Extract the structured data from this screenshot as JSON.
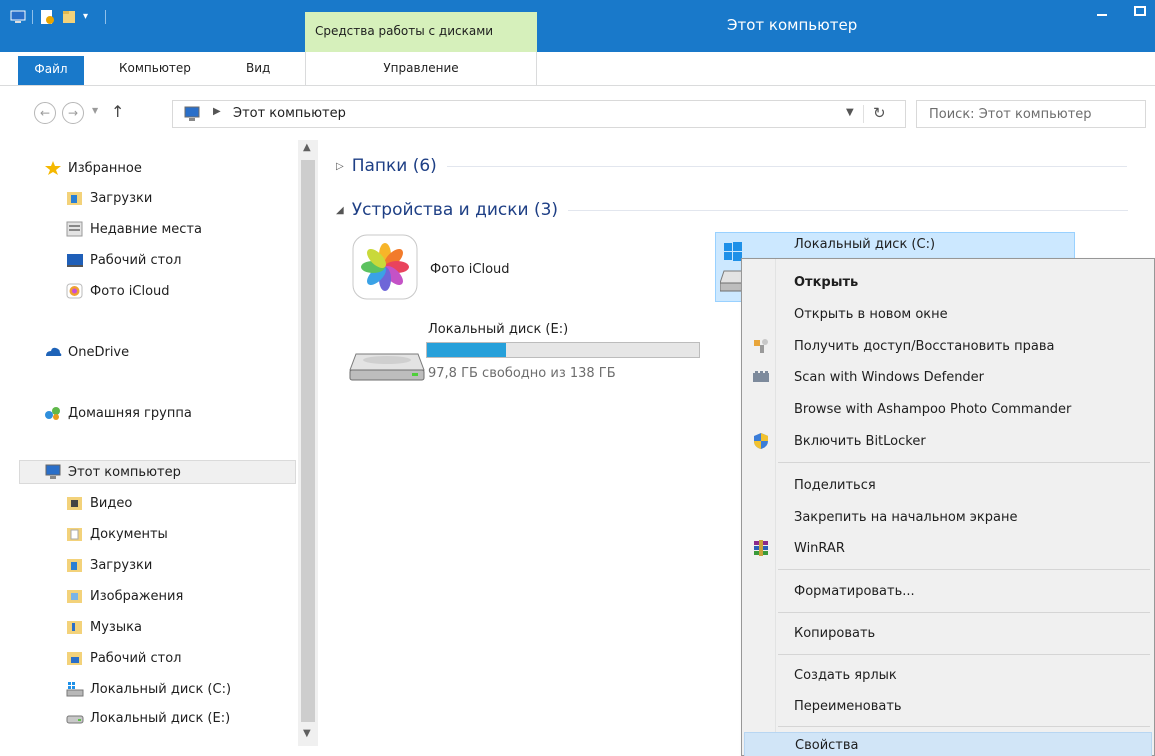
{
  "window": {
    "title": "Этот компьютер",
    "context_tab_group": "Средства работы с дисками"
  },
  "ribbon": {
    "tabs": [
      {
        "label": "Файл"
      },
      {
        "label": "Компьютер"
      },
      {
        "label": "Вид"
      },
      {
        "label": "Управление"
      }
    ]
  },
  "address": {
    "path": "Этот компьютер",
    "search_placeholder": "Поиск: Этот компьютер"
  },
  "navpane": {
    "items": [
      {
        "label": "Избранное",
        "icon": "star-icon"
      },
      {
        "label": "Загрузки",
        "icon": "downloads-folder-icon"
      },
      {
        "label": "Недавние места",
        "icon": "recent-places-icon"
      },
      {
        "label": "Рабочий стол",
        "icon": "desktop-icon"
      },
      {
        "label": "Фото iCloud",
        "icon": "icloud-photos-icon"
      },
      {
        "label": "OneDrive",
        "icon": "onedrive-icon"
      },
      {
        "label": "Домашняя группа",
        "icon": "homegroup-icon"
      },
      {
        "label": "Этот компьютер",
        "icon": "computer-icon"
      },
      {
        "label": "Видео",
        "icon": "video-folder-icon"
      },
      {
        "label": "Документы",
        "icon": "documents-folder-icon"
      },
      {
        "label": "Загрузки",
        "icon": "downloads-folder-icon"
      },
      {
        "label": "Изображения",
        "icon": "pictures-folder-icon"
      },
      {
        "label": "Музыка",
        "icon": "music-folder-icon"
      },
      {
        "label": "Рабочий стол",
        "icon": "desktop-folder-icon"
      },
      {
        "label": "Локальный диск (C:)",
        "icon": "system-drive-icon"
      },
      {
        "label": "Локальный диск (E:)",
        "icon": "drive-icon"
      }
    ]
  },
  "content": {
    "groups": [
      {
        "label": "Папки (6)",
        "expanded": false
      },
      {
        "label": "Устройства и диски (3)",
        "expanded": true
      }
    ],
    "devices": [
      {
        "label": "Фото iCloud",
        "icon": "icloud-photos-icon"
      },
      {
        "label": "Локальный диск (E:)",
        "free_text": "97,8 ГБ свободно из 138 ГБ",
        "used_fraction": 0.29,
        "icon": "drive-icon"
      },
      {
        "label": "Локальный диск (C:)",
        "icon": "system-drive-icon",
        "selected": true
      }
    ]
  },
  "context_menu": {
    "items": [
      {
        "label": "Открыть",
        "bold": true
      },
      {
        "label": "Открыть в новом окне"
      },
      {
        "label": "Получить доступ/Восстановить права",
        "icon": "take-ownership-icon"
      },
      {
        "label": "Scan with Windows Defender",
        "icon": "defender-icon"
      },
      {
        "label": "Browse with Ashampoo Photo Commander"
      },
      {
        "label": "Включить BitLocker",
        "icon": "shield-icon"
      },
      {
        "label": "Поделиться"
      },
      {
        "label": "Закрепить на начальном экране"
      },
      {
        "label": "WinRAR",
        "icon": "winrar-icon"
      },
      {
        "label": "Форматировать..."
      },
      {
        "label": "Копировать"
      },
      {
        "label": "Создать ярлык"
      },
      {
        "label": "Переименовать"
      },
      {
        "label": "Свойства",
        "hover": true
      }
    ]
  },
  "colors": {
    "accent": "#1979ca",
    "context_tab": "#d6f0bb",
    "selection": "#cce8ff",
    "capacity_fill": "#26a0da",
    "group_header": "#1e3f85"
  }
}
